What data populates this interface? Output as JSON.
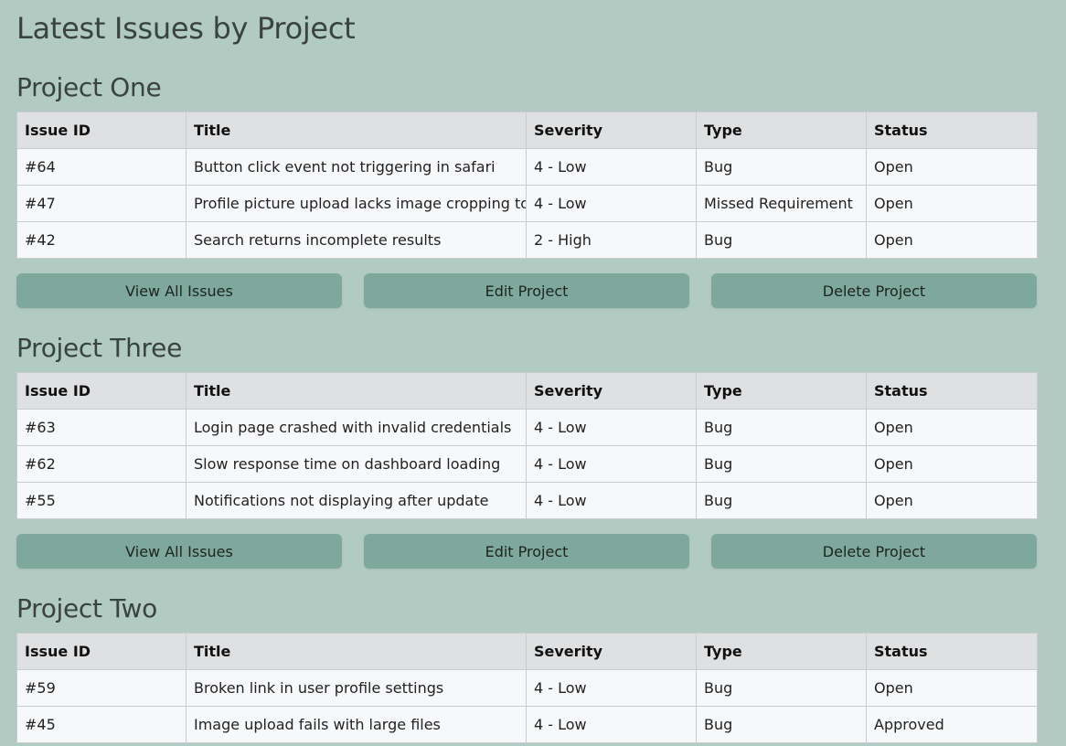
{
  "page": {
    "title": "Latest Issues by Project"
  },
  "table_headers": [
    "Issue ID",
    "Title",
    "Severity",
    "Type",
    "Status"
  ],
  "buttons": {
    "view_all": "View All Issues",
    "edit": "Edit Project",
    "delete": "Delete Project"
  },
  "projects": [
    {
      "name": "Project One",
      "issues": [
        {
          "id": "#64",
          "title": "Button click event not triggering in safari",
          "severity": "4 - Low",
          "type": "Bug",
          "status": "Open"
        },
        {
          "id": "#47",
          "title": "Profile picture upload lacks image cropping tool",
          "severity": "4 - Low",
          "type": "Missed Requirement",
          "status": "Open"
        },
        {
          "id": "#42",
          "title": "Search returns incomplete results",
          "severity": "2 - High",
          "type": "Bug",
          "status": "Open"
        }
      ]
    },
    {
      "name": "Project Three",
      "issues": [
        {
          "id": "#63",
          "title": "Login page crashed with invalid credentials",
          "severity": "4 - Low",
          "type": "Bug",
          "status": "Open"
        },
        {
          "id": "#62",
          "title": "Slow response time on dashboard loading",
          "severity": "4 - Low",
          "type": "Bug",
          "status": "Open"
        },
        {
          "id": "#55",
          "title": "Notifications not displaying after update",
          "severity": "4 - Low",
          "type": "Bug",
          "status": "Open"
        }
      ]
    },
    {
      "name": "Project Two",
      "issues": [
        {
          "id": "#59",
          "title": "Broken link in user profile settings",
          "severity": "4 - Low",
          "type": "Bug",
          "status": "Open"
        },
        {
          "id": "#45",
          "title": "Image upload fails with large files",
          "severity": "4 - Low",
          "type": "Bug",
          "status": "Approved"
        }
      ]
    }
  ]
}
